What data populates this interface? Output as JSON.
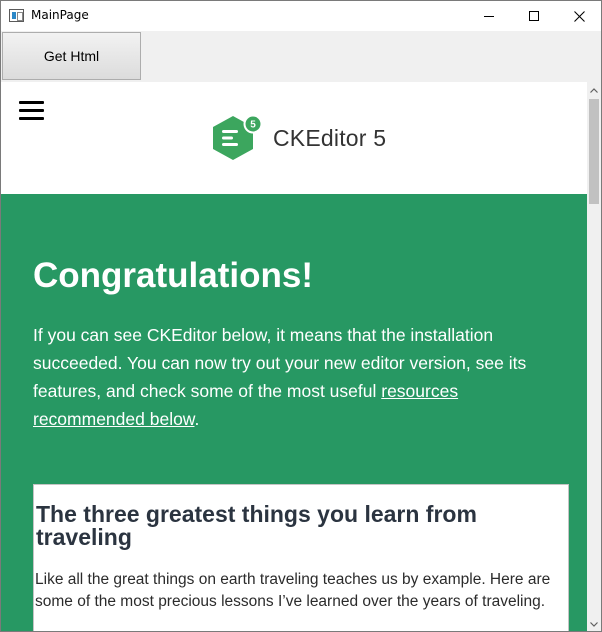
{
  "window": {
    "title": "MainPage"
  },
  "toolbar": {
    "get_html_label": "Get Html"
  },
  "header": {
    "logo_text": "CKEditor 5",
    "logo_badge": "5"
  },
  "hero": {
    "title": "Congratulations!",
    "text_before_link": "If you can see CKEditor below, it means that the installation succeeded. You can now try out your new editor version, see its features, and check some of the most useful ",
    "link_text": "resources recommended below",
    "text_after_link": "."
  },
  "editor": {
    "heading": "The three greatest things you learn from traveling",
    "paragraph": "Like all the great things on earth traveling teaches us by example. Here are some of the most precious lessons I’ve learned over the years of traveling."
  },
  "colors": {
    "hero_background": "#279863",
    "logo_green": "#3ca65e"
  },
  "icons": {
    "menu": "hamburger-icon",
    "logo": "ckeditor-logo-icon",
    "minimize": "minimize-icon",
    "maximize": "maximize-icon",
    "close": "close-icon"
  }
}
